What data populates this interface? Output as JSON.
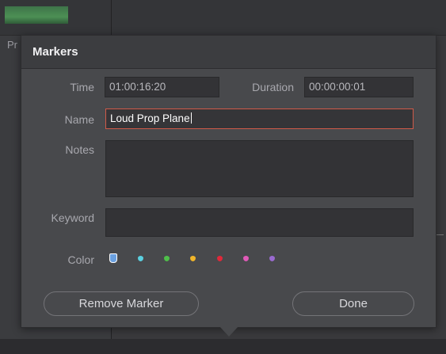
{
  "background": {
    "clip_label": "Pr"
  },
  "dialog": {
    "title": "Markers",
    "fields": {
      "time_label": "Time",
      "time_value": "01:00:16:20",
      "duration_label": "Duration",
      "duration_value": "00:00:00:01",
      "name_label": "Name",
      "name_value": "Loud Prop Plane",
      "notes_label": "Notes",
      "notes_value": "",
      "keyword_label": "Keyword",
      "keyword_value": ""
    },
    "color_label": "Color",
    "colors": [
      {
        "name": "Blue",
        "hex": "#6aa0e0",
        "selected": true
      },
      {
        "name": "Cyan",
        "hex": "#5bd0e0"
      },
      {
        "name": "Green",
        "hex": "#4fbf4a"
      },
      {
        "name": "Yellow",
        "hex": "#f0b52a"
      },
      {
        "name": "Red",
        "hex": "#e0283a"
      },
      {
        "name": "Pink",
        "hex": "#e05ab8"
      },
      {
        "name": "Purple",
        "hex": "#9a6ad0"
      }
    ],
    "remove_button": "Remove Marker",
    "done_button": "Done"
  },
  "accent_colors": {
    "active_field_border": "#d05a48",
    "dialog_bg": "#48494c"
  }
}
